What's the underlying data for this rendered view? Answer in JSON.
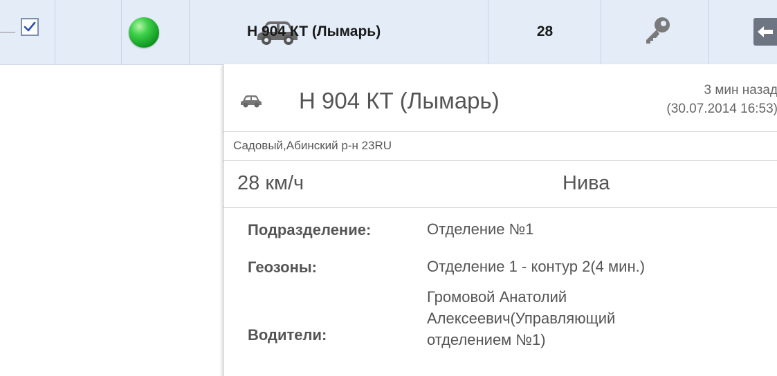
{
  "row": {
    "checked": true,
    "status_color": "#2fbf3a",
    "vehicle_icon": "car-icon",
    "vehicle_name": "Н 904 КТ (Лымарь)",
    "speed": "28",
    "key_icon": "key-icon",
    "action_icon": "arrow-left-icon"
  },
  "popup": {
    "vehicle_icon": "car-icon",
    "title": "Н 904 КТ (Лымарь)",
    "time_ago": "3 мин назад",
    "datetime": "(30.07.2014 16:53)",
    "address": "Садовый,Абинский р-н 23RU",
    "speed": "28 км/ч",
    "model": "Нива",
    "division_label": "Подразделение:",
    "division_value": "Отделение №1",
    "geozones_label": "Геозоны:",
    "geozones_value": "Отделение 1 - контур 2(4 мин.)",
    "drivers_label": "Водители:",
    "drivers_lines": [
      "Громовой Анатолий",
      "Алексеевич(Управляющий",
      "отделением №1)"
    ]
  }
}
